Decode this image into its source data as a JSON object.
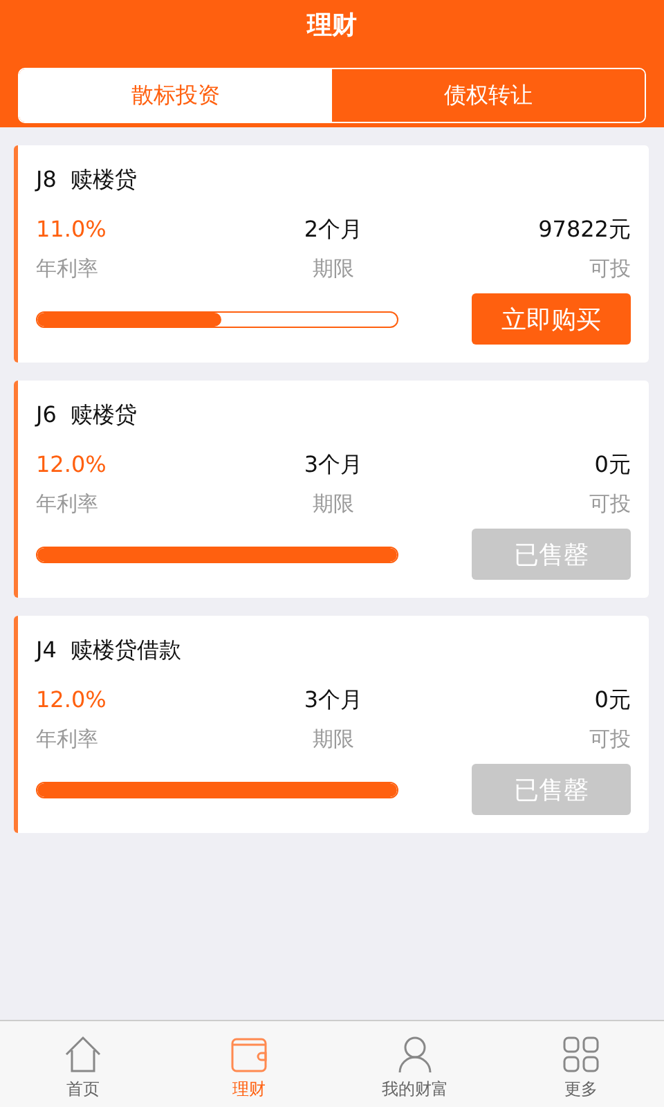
{
  "header": {
    "title": "理财"
  },
  "tabs": [
    {
      "label": "散标投资",
      "selected": true
    },
    {
      "label": "债权转让",
      "selected": false
    }
  ],
  "loans": [
    {
      "code": "J8",
      "name": "赎楼贷",
      "rate": "11.0%",
      "rate_label": "年利率",
      "term": "2个月",
      "term_label": "期限",
      "available": "97822元",
      "available_label": "可投",
      "level": 0.51,
      "button": {
        "label": "立即购买",
        "disabled": false
      }
    },
    {
      "code": "J6",
      "name": "赎楼贷",
      "rate": "12.0%",
      "rate_label": "年利率",
      "term": "3个月",
      "term_label": "期限",
      "available": "0元",
      "available_label": "可投",
      "level": 1,
      "button": {
        "label": "已售罄",
        "disabled": true
      }
    },
    {
      "code": "J4",
      "name": "赎楼贷借款",
      "rate": "12.0%",
      "rate_label": "年利率",
      "term": "3个月",
      "term_label": "期限",
      "available": "0元",
      "available_label": "可投",
      "level": 1,
      "button": {
        "label": "已售罄",
        "disabled": true
      }
    }
  ],
  "nav": [
    {
      "kind": "home",
      "label": "首页",
      "selected": false
    },
    {
      "kind": "wallet",
      "label": "理财",
      "selected": true
    },
    {
      "kind": "person",
      "label": "我的财富",
      "selected": false
    },
    {
      "kind": "grid",
      "label": "更多",
      "selected": false
    }
  ]
}
